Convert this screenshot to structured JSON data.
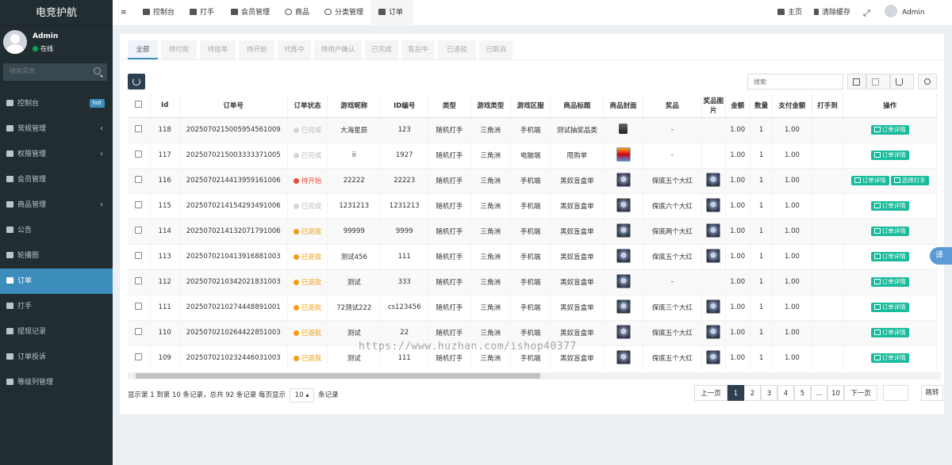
{
  "app_title": "电竞护航",
  "user": {
    "name": "Admin",
    "status": "在线"
  },
  "search_placeholder": "搜索菜单",
  "menu": [
    {
      "label": "控制台",
      "icon": "dashboard-icon",
      "badge": "hot"
    },
    {
      "label": "常规管理",
      "icon": "gears-icon",
      "chevron": "‹"
    },
    {
      "label": "权限管理",
      "icon": "group-icon",
      "chevron": "‹"
    },
    {
      "label": "会员管理",
      "icon": "user-icon"
    },
    {
      "label": "商品管理",
      "icon": "grid-icon",
      "chevron": "‹"
    },
    {
      "label": "公告",
      "icon": "list-icon"
    },
    {
      "label": "轮播图",
      "icon": "list-icon"
    },
    {
      "label": "订单",
      "icon": "list-icon",
      "active": true
    },
    {
      "label": "打手",
      "icon": "list-icon"
    },
    {
      "label": "提现记录",
      "icon": "list-icon"
    },
    {
      "label": "订单投诉",
      "icon": "list-icon"
    },
    {
      "label": "等级列管理",
      "icon": "list-icon"
    }
  ],
  "topnav": {
    "menu_toggle": "≡",
    "items": [
      "控制台",
      "打手",
      "会员管理",
      "商品",
      "分类管理",
      "订单"
    ],
    "home": "主页",
    "clear_cache": "清除缓存",
    "fullscreen": "⤢",
    "admin": "Admin"
  },
  "status_tabs": [
    "全部",
    "待付款",
    "待接单",
    "待开始",
    "代练中",
    "待用户确认",
    "已完成",
    "售后中",
    "已退款",
    "已取消"
  ],
  "table_search_placeholder": "搜索",
  "columns": [
    "Id",
    "订单号",
    "订单状态",
    "游戏昵称",
    "ID编号",
    "类型",
    "游戏类型",
    "游戏区服",
    "商品标题",
    "商品封面",
    "奖品",
    "奖品图片",
    "金额",
    "数量",
    "支付金额",
    "打手到",
    "操作"
  ],
  "status_colors": {
    "已完成": "#d2d6de",
    "待开始": "#e74c3c",
    "已退款": "#f39c12"
  },
  "rows": [
    {
      "id": "118",
      "order_no": "2025070215005954561009",
      "status": "已完成",
      "nickname": "大海星辰",
      "id_no": "123",
      "type": "随机打手",
      "game": "三角洲",
      "server": "手机端",
      "title": "测试抽奖品类",
      "cover": "sm",
      "prize": "-",
      "prize_img": false,
      "amount": "1.00",
      "qty": "1",
      "paid": "1.00",
      "ops": [
        "订单详情"
      ]
    },
    {
      "id": "117",
      "order_no": "2025070215003333371005",
      "status": "已完成",
      "nickname": "ii",
      "id_no": "1927",
      "type": "随机打手",
      "game": "三角洲",
      "server": "电脑端",
      "title": "限购单",
      "cover": "logo",
      "prize": "-",
      "prize_img": false,
      "amount": "1.00",
      "qty": "1",
      "paid": "1.00",
      "ops": [
        "订单详情"
      ]
    },
    {
      "id": "116",
      "order_no": "2025070214413959161006",
      "status": "待开始",
      "nickname": "22222",
      "id_no": "22223",
      "type": "随机打手",
      "game": "三角洲",
      "server": "手机端",
      "title": "黑奴盲盒单",
      "cover": "box",
      "prize": "保底五个大红",
      "prize_img": true,
      "amount": "1.00",
      "qty": "1",
      "paid": "1.00",
      "ops": [
        "订单详情",
        "选择打手"
      ]
    },
    {
      "id": "115",
      "order_no": "2025070214154293491006",
      "status": "已完成",
      "nickname": "1231213",
      "id_no": "1231213",
      "type": "随机打手",
      "game": "三角洲",
      "server": "手机端",
      "title": "黑奴盲盒单",
      "cover": "box",
      "prize": "保底六个大红",
      "prize_img": true,
      "amount": "1.00",
      "qty": "1",
      "paid": "1.00",
      "ops": [
        "订单详情"
      ]
    },
    {
      "id": "114",
      "order_no": "2025070214132071791006",
      "status": "已退款",
      "nickname": "99999",
      "id_no": "9999",
      "type": "随机打手",
      "game": "三角洲",
      "server": "手机端",
      "title": "黑奴盲盒单",
      "cover": "box",
      "prize": "保底两个大红",
      "prize_img": true,
      "amount": "1.00",
      "qty": "1",
      "paid": "1.00",
      "ops": [
        "订单详情"
      ]
    },
    {
      "id": "113",
      "order_no": "2025070210413916881003",
      "status": "已退款",
      "nickname": "测试456",
      "id_no": "111",
      "type": "随机打手",
      "game": "三角洲",
      "server": "手机端",
      "title": "黑奴盲盒单",
      "cover": "box",
      "prize": "保底五个大红",
      "prize_img": true,
      "amount": "1.00",
      "qty": "1",
      "paid": "1.00",
      "ops": [
        "订单详情"
      ]
    },
    {
      "id": "112",
      "order_no": "2025070210342021831003",
      "status": "已退款",
      "nickname": "测试",
      "id_no": "333",
      "type": "随机打手",
      "game": "三角洲",
      "server": "手机端",
      "title": "黑奴盲盒单",
      "cover": "box",
      "prize": "-",
      "prize_img": false,
      "amount": "1.00",
      "qty": "1",
      "paid": "1.00",
      "ops": [
        "订单详情"
      ]
    },
    {
      "id": "111",
      "order_no": "2025070210274448891001",
      "status": "已退款",
      "nickname": "72测试222",
      "id_no": "cs123456",
      "type": "随机打手",
      "game": "三角洲",
      "server": "手机端",
      "title": "黑奴盲盒单",
      "cover": "box",
      "prize": "保底三个大红",
      "prize_img": true,
      "amount": "1.00",
      "qty": "1",
      "paid": "1.00",
      "ops": [
        "订单详情"
      ]
    },
    {
      "id": "110",
      "order_no": "2025070210264422851003",
      "status": "已退款",
      "nickname": "测试",
      "id_no": "22",
      "type": "随机打手",
      "game": "三角洲",
      "server": "手机端",
      "title": "黑奴盲盒单",
      "cover": "box",
      "prize": "保底五个大红",
      "prize_img": true,
      "amount": "1.00",
      "qty": "1",
      "paid": "1.00",
      "ops": [
        "订单详情"
      ]
    },
    {
      "id": "109",
      "order_no": "2025070210232446031003",
      "status": "已退款",
      "nickname": "测试",
      "id_no": "111",
      "type": "随机打手",
      "game": "三角洲",
      "server": "手机端",
      "title": "黑奴盲盒单",
      "cover": "box",
      "prize": "保底五个大红",
      "prize_img": true,
      "amount": "1.00",
      "qty": "1",
      "paid": "1.00",
      "ops": [
        "订单详情"
      ]
    }
  ],
  "pagination": {
    "info_prefix": "显示第 1 到第 10 条记录，总共 92 条记录 每页显示",
    "page_size": "10",
    "info_suffix": "条记录",
    "prev": "上一页",
    "pages": [
      "1",
      "2",
      "3",
      "4",
      "5",
      "...",
      "10"
    ],
    "next": "下一页",
    "go": "跳转"
  },
  "watermark": "https://www.huzhan.com/ishop40377",
  "float_button": "译"
}
